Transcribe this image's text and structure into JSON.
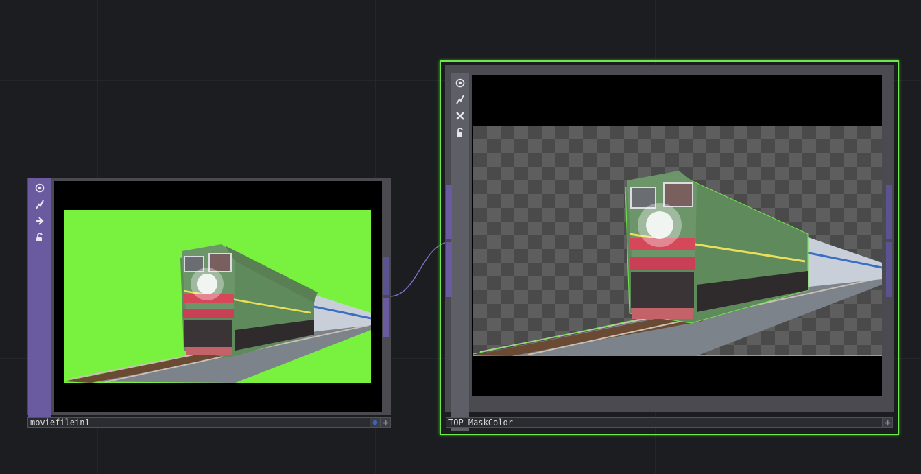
{
  "nodes": {
    "source": {
      "name": "moviefilein1",
      "flags": [
        "viewer-active-icon",
        "bypass-icon",
        "display-icon",
        "lock-icon"
      ]
    },
    "mask": {
      "name": "TOP_MaskColor",
      "flags": [
        "viewer-active-icon",
        "bypass-icon",
        "close-icon",
        "lock-icon"
      ]
    }
  },
  "colors": {
    "background": "#1c1d21",
    "node_strip": "#6a5aa0",
    "selection": "#6fe84a",
    "green_screen": "#78f23e",
    "wire": "#7d6fc0"
  }
}
